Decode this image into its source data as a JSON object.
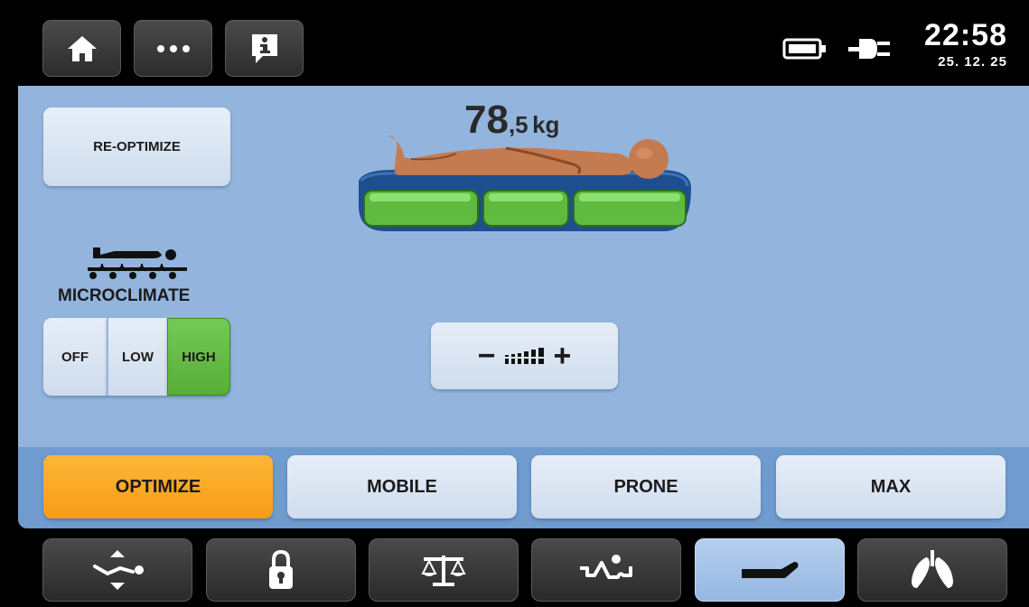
{
  "header": {
    "home_icon": "home-icon",
    "more_icon": "ellipsis-icon",
    "info_icon": "info-icon",
    "battery_icon": "battery-icon",
    "power_icon": "plug-icon",
    "time": "22:58",
    "date": "25. 12. 25"
  },
  "main": {
    "reoptimize_label": "RE-OPTIMIZE",
    "weight_whole": "78",
    "weight_fraction": ",5",
    "weight_unit": "kg",
    "microclimate": {
      "title": "MICROCLIMATE",
      "options": [
        "OFF",
        "LOW",
        "HIGH"
      ],
      "selected": "HIGH"
    },
    "firmness_minus": "−",
    "firmness_plus": "+",
    "firmness_level": 0.6
  },
  "modes": {
    "items": [
      "OPTIMIZE",
      "MOBILE",
      "PRONE",
      "MAX"
    ],
    "active": "OPTIMIZE"
  },
  "nav": {
    "items": [
      "position-icon",
      "lock-icon",
      "scale-icon",
      "turn-assist-icon",
      "mattress-icon",
      "lungs-icon"
    ],
    "active": "mattress-icon"
  },
  "colors": {
    "panel": "#93b5dd",
    "mode_bar": "#6f9bcf",
    "active_orange": "#f9a825",
    "active_green": "#6cc04a",
    "button_light": "#dce6f3"
  }
}
